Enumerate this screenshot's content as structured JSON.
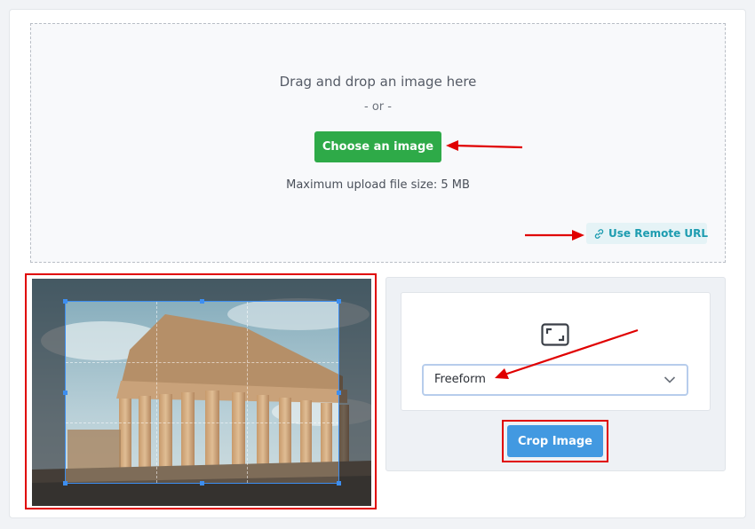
{
  "dropzone": {
    "title": "Drag and drop an image here",
    "or_text": "- or -",
    "choose_label": "Choose an image",
    "max_size_text": "Maximum upload file size: 5 MB",
    "remote_url_label": "Use Remote URL"
  },
  "cropper": {
    "aspect_icon": "aspect-ratio-icon",
    "aspect_select_value": "Freeform",
    "crop_button_label": "Crop Image"
  },
  "colors": {
    "choose_button": "#2eaa48",
    "crop_button": "#4299e1",
    "remote_url_text": "#1d9cb0",
    "annotation_red": "#e00000",
    "crop_box": "#3d8ef0"
  }
}
